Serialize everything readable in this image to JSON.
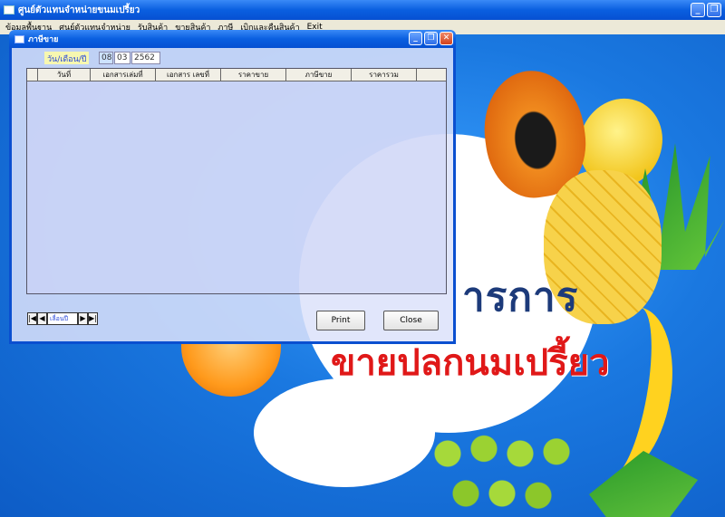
{
  "app": {
    "title": "ศูนย์ตัวแทนจำหน่ายขนมเปรี้ยว",
    "window_buttons": {
      "minimize": "_",
      "restore": "❐",
      "close": "✕"
    }
  },
  "menu": {
    "items": [
      "ข้อมูลพื้นฐาน",
      "ศูนย์ตัวแทนจำหน่าย",
      "รับสินค้า",
      "ขายสินค้า",
      "ภาษี",
      "เบิกและคืนสินค้า",
      "Exit"
    ]
  },
  "background": {
    "hero_line1": "ารการ",
    "hero_line2": "ขายปลกนมเปรี้ยว"
  },
  "child_window": {
    "title": "ภาษีขาย",
    "date_label": "วัน/เดือน/ปี",
    "date": {
      "day": "08",
      "month": "03",
      "year": "2562"
    },
    "columns": [
      "วันที่",
      "เอกสารเล่มที่",
      "เอกสาร เลขที่",
      "ราคาขาย",
      "ภาษีขาย",
      "ราคารวม"
    ],
    "navigator": {
      "first": "|◀",
      "prev": "◀",
      "caption": "เลื่อนปี",
      "next": "▶",
      "last": "▶|"
    },
    "buttons": {
      "print": "Print",
      "close": "Close"
    }
  }
}
